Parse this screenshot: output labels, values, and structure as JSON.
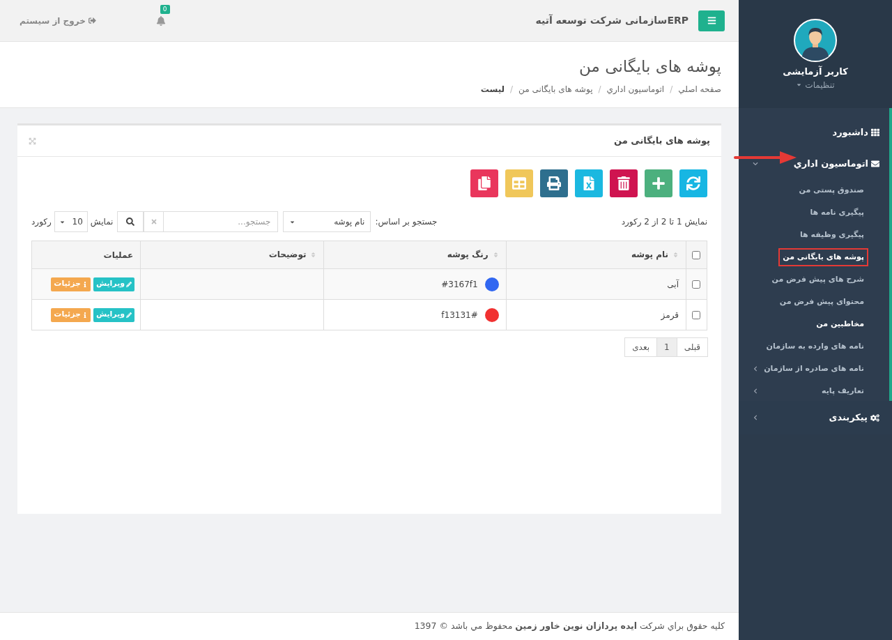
{
  "topbar": {
    "brand": "ERPسازمانی شرکت توسعه آتیه",
    "notifications": "0",
    "logout": "خروج از سیستم"
  },
  "page": {
    "title": "پوشه های بایگانی من",
    "breadcrumb": [
      {
        "label": "صفحه اصلي",
        "current": false
      },
      {
        "separator": "/",
        "label": "اتوماسیون اداري",
        "current": false
      },
      {
        "separator": "/",
        "label": "پوشه های بایگانی من",
        "current": false
      },
      {
        "separator": "/",
        "label": "لیست",
        "current": true
      }
    ]
  },
  "card": {
    "title": "پوشه های بایگانی من",
    "toolbar": [
      {
        "kind": "refresh",
        "color": "#17b6e3"
      },
      {
        "kind": "add",
        "color": "#4cb07e"
      },
      {
        "kind": "delete",
        "color": "#cf1450"
      },
      {
        "kind": "excel",
        "color": "#1bb8e0"
      },
      {
        "kind": "print",
        "color": "#2e6f8e"
      },
      {
        "kind": "grid",
        "color": "#f0c75a"
      },
      {
        "kind": "copy",
        "color": "#e9365c"
      }
    ],
    "info": "نمایش 1 تا 2 از 2 رکورد",
    "search": {
      "label": "جستجو بر اساس:",
      "field": "نام پوشه",
      "placeholder": "جستجو..."
    },
    "page_size": {
      "prefix": "نمایش",
      "value": "10",
      "suffix": "رکورد"
    },
    "columns": [
      {
        "label": "نام پوشه",
        "sortable": true
      },
      {
        "label": "رنگ پوشه",
        "sortable": true
      },
      {
        "label": "توضیحات",
        "sortable": true
      },
      {
        "label": "عملیات",
        "sortable": false
      }
    ],
    "select_all": {
      "checked": false
    },
    "rows": [
      {
        "checked": false,
        "name": "آبی",
        "color": "#3167f1",
        "color_text": "#3167f1",
        "actions": [
          {
            "kind": "edit",
            "label": "ویرایش"
          },
          {
            "kind": "details",
            "label": "جزئیات"
          }
        ]
      },
      {
        "checked": false,
        "name": "قرمز",
        "color": "#f13131",
        "color_text": "f13131#",
        "actions": [
          {
            "kind": "edit",
            "label": "ویرایش"
          },
          {
            "kind": "details",
            "label": "جزئیات"
          }
        ]
      }
    ],
    "pagination": [
      {
        "label": "قبلی",
        "selected": false
      },
      {
        "label": "1",
        "selected": true
      },
      {
        "label": "بعدی",
        "selected": false
      }
    ]
  },
  "footer": "کلیه حقوق براي شرکت **ایده پردازان نوین خاور زمین** محفوظ مي باشد © 1397",
  "sidebar": {
    "user": {
      "name": "کاربر آزمایشی",
      "settings": "تنظیمات"
    },
    "menu": [
      {
        "label": "داشبورد",
        "has_children": false
      },
      {
        "label": "اتوماسیون اداري",
        "expanded": true,
        "has_children": true,
        "children": [
          {
            "label": "صندوق پستی من",
            "selected": false,
            "active": false,
            "has_children": false
          },
          {
            "label": "پیگیری نامه ها",
            "selected": false,
            "active": false,
            "has_children": false
          },
          {
            "label": "پیگیری وظیفه ها",
            "selected": false,
            "active": false,
            "has_children": false
          },
          {
            "label": "پوشه های بایگانی من",
            "selected": true,
            "active": false,
            "has_children": false
          },
          {
            "label": "شرح های پیش فرض من",
            "selected": false,
            "active": false,
            "has_children": false
          },
          {
            "label": "محتوای پیش فرض من",
            "selected": false,
            "active": false,
            "has_children": false
          },
          {
            "label": "مخاطبین من",
            "selected": false,
            "active": true,
            "has_children": false
          },
          {
            "label": "نامه های وارده به سازمان",
            "selected": false,
            "active": false,
            "has_children": false
          },
          {
            "label": "نامه های صادره از سازمان",
            "selected": false,
            "active": false,
            "has_children": true
          },
          {
            "label": "تعاریف پایه",
            "selected": false,
            "active": false,
            "has_children": true
          }
        ]
      }
    ],
    "config": {
      "label": "پیکربندی",
      "expanded": false,
      "has_children": true
    }
  }
}
